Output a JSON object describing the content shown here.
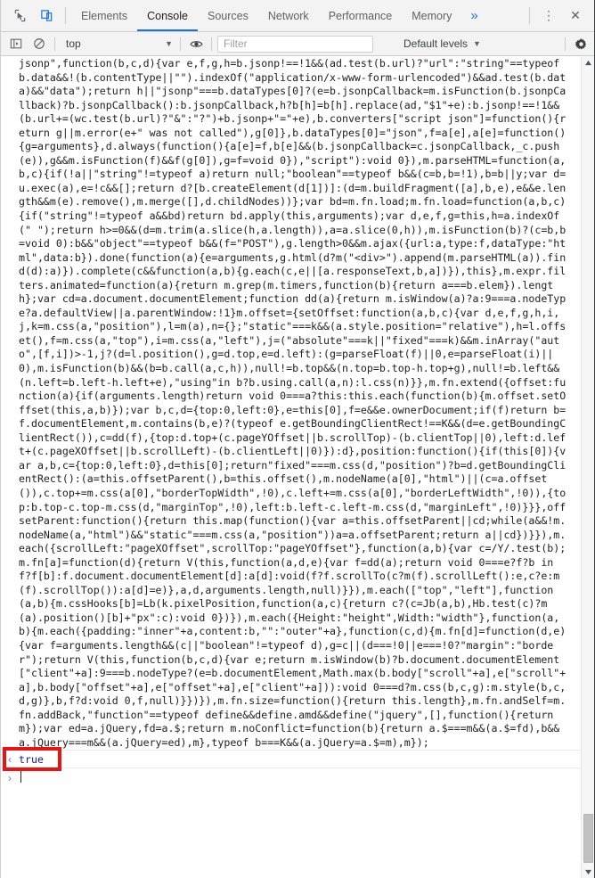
{
  "window": {
    "title": "Chrome DevTools - Console"
  },
  "tabbar": {
    "inspect_icon": "inspect-cursor-icon",
    "device_icon": "device-toolbar-icon",
    "tabs": [
      {
        "label": "Elements",
        "active": false
      },
      {
        "label": "Console",
        "active": true
      },
      {
        "label": "Sources",
        "active": false
      },
      {
        "label": "Network",
        "active": false
      },
      {
        "label": "Performance",
        "active": false
      },
      {
        "label": "Memory",
        "active": false
      }
    ],
    "more_tabs_label": "»",
    "menu_label": "⋮",
    "close_label": "✕",
    "active_underline_color": "#1a73e8",
    "more_tabs_color": "#1a73e8"
  },
  "console_toolbar": {
    "sidebar_toggle_icon": "show-console-sidebar-icon",
    "clear_icon": "clear-console-icon",
    "context": {
      "value": "top",
      "caret": "▼"
    },
    "eye_icon": "create-live-expression-icon",
    "filter": {
      "placeholder": "Filter",
      "value": ""
    },
    "levels": {
      "label": "Default levels",
      "caret": "▼"
    },
    "settings_icon": "gear-icon"
  },
  "console": {
    "log_gutter_marker": "",
    "log_text": "jsonp\",function(b,c,d){var e,f,g,h=b.jsonp!==!1&&(ad.test(b.url)?\"url\":\"string\"==typeof b.data&&!(b.contentType||\"\").indexOf(\"application/x-www-form-urlencoded\")&&ad.test(b.data)&&\"data\");return h||\"jsonp\"===b.dataTypes[0]?(e=b.jsonpCallback=m.isFunction(b.jsonpCallback)?b.jsonpCallback():b.jsonpCallback,h?b[h]=b[h].replace(ad,\"$1\"+e):b.jsonp!==!1&&(b.url+=(wc.test(b.url)?\"&\":\"?\")+b.jsonp+\"=\"+e),b.converters[\"script json\"]=function(){return g||m.error(e+\" was not called\"),g[0]},b.dataTypes[0]=\"json\",f=a[e],a[e]=function(){g=arguments},d.always(function(){a[e]=f,b[e]&&(b.jsonpCallback=c.jsonpCallback,_c.push(e)),g&&m.isFunction(f)&&f(g[0]),g=f=void 0}),\"script\"):void 0}),m.parseHTML=function(a,b,c){if(!a||\"string\"!=typeof a)return null;\"boolean\"==typeof b&&(c=b,b=!1),b=b||y;var d=u.exec(a),e=!c&&[];return d?[b.createElement(d[1])]:(d=m.buildFragment([a],b,e),e&&e.length&&m(e).remove(),m.merge([],d.childNodes))};var bd=m.fn.load;m.fn.load=function(a,b,c){if(\"string\"!=typeof a&&bd)return bd.apply(this,arguments);var d,e,f,g=this,h=a.indexOf(\" \");return h>=0&&(d=m.trim(a.slice(h,a.length)),a=a.slice(0,h)),m.isFunction(b)?(c=b,b=void 0):b&&\"object\"==typeof b&&(f=\"POST\"),g.length>0&&m.ajax({url:a,type:f,dataType:\"html\",data:b}).done(function(a){e=arguments,g.html(d?m(\"<div>\").append(m.parseHTML(a)).find(d):a)}).complete(c&&function(a,b){g.each(c,e||[a.responseText,b,a])}),this},m.expr.filters.animated=function(a){return m.grep(m.timers,function(b){return a===b.elem}).length};var cd=a.document.documentElement;function dd(a){return m.isWindow(a)?a:9===a.nodeType?a.defaultView||a.parentWindow:!1}m.offset={setOffset:function(a,b,c){var d,e,f,g,h,i,j,k=m.css(a,\"position\"),l=m(a),n={};\"static\"===k&&(a.style.position=\"relative\"),h=l.offset(),f=m.css(a,\"top\"),i=m.css(a,\"left\"),j=(\"absolute\"===k||\"fixed\"===k)&&m.inArray(\"auto\",[f,i])>-1,j?(d=l.position(),g=d.top,e=d.left):(g=parseFloat(f)||0,e=parseFloat(i)||0),m.isFunction(b)&&(b=b.call(a,c,h)),null!=b.top&&(n.top=b.top-h.top+g),null!=b.left&&(n.left=b.left-h.left+e),\"using\"in b?b.using.call(a,n):l.css(n)}},m.fn.extend({offset:function(a){if(arguments.length)return void 0===a?this:this.each(function(b){m.offset.setOffset(this,a,b)});var b,c,d={top:0,left:0},e=this[0],f=e&&e.ownerDocument;if(f)return b=f.documentElement,m.contains(b,e)?(typeof e.getBoundingClientRect!==K&&(d=e.getBoundingClientRect()),c=dd(f),{top:d.top+(c.pageYOffset||b.scrollTop)-(b.clientTop||0),left:d.left+(c.pageXOffset||b.scrollLeft)-(b.clientLeft||0)}):d},position:function(){if(this[0]){var a,b,c={top:0,left:0},d=this[0];return\"fixed\"===m.css(d,\"position\")?b=d.getBoundingClientRect():(a=this.offsetParent(),b=this.offset(),m.nodeName(a[0],\"html\")||(c=a.offset()),c.top+=m.css(a[0],\"borderTopWidth\",!0),c.left+=m.css(a[0],\"borderLeftWidth\",!0)),{top:b.top-c.top-m.css(d,\"marginTop\",!0),left:b.left-c.left-m.css(d,\"marginLeft\",!0)}}},offsetParent:function(){return this.map(function(){var a=this.offsetParent||cd;while(a&&!m.nodeName(a,\"html\")&&\"static\"===m.css(a,\"position\"))a=a.offsetParent;return a||cd})}}),m.each({scrollLeft:\"pageXOffset\",scrollTop:\"pageYOffset\"},function(a,b){var c=/Y/.test(b);m.fn[a]=function(d){return V(this,function(a,d,e){var f=dd(a);return void 0===e?f?b in f?f[b]:f.document.documentElement[d]:a[d]:void(f?f.scrollTo(c?m(f).scrollLeft():e,c?e:m(f).scrollTop()):a[d]=e)},a,d,arguments.length,null)}}),m.each([\"top\",\"left\"],function(a,b){m.cssHooks[b]=Lb(k.pixelPosition,function(a,c){return c?(c=Jb(a,b),Hb.test(c)?m(a).position()[b]+\"px\":c):void 0})}),m.each({Height:\"height\",Width:\"width\"},function(a,b){m.each({padding:\"inner\"+a,content:b,\"\":\"outer\"+a},function(c,d){m.fn[d]=function(d,e){var f=arguments.length&&(c||\"boolean\"!=typeof d),g=c||(d===!0||e===!0?\"margin\":\"border\");return V(this,function(b,c,d){var e;return m.isWindow(b)?b.document.documentElement[\"client\"+a]:9===b.nodeType?(e=b.documentElement,Math.max(b.body[\"scroll\"+a],e[\"scroll\"+a],b.body[\"offset\"+a],e[\"offset\"+a],e[\"client\"+a])):void 0===d?m.css(b,c,g):m.style(b,c,d,g)},b,f?d:void 0,f,null)}})}),m.fn.size=function(){return this.length},m.fn.andSelf=m.fn.addBack,\"function\"==typeof define&&define.amd&&define(\"jquery\",[],function(){return m});var ed=a.jQuery,fd=a.$;return m.noConflict=function(b){return a.$===m&&(a.$=fd),b&&a.jQuery===m&&(a.jQuery=ed),m},typeof b===K&&(a.jQuery=a.$=m),m});",
    "result_marker": "‹",
    "result_value": "true",
    "result_color": "#1a1aa6",
    "prompt_marker": "›",
    "prompt_value": ""
  },
  "scrollbar": {
    "up_arrow": "scroll-up-arrow",
    "down_arrow": "scroll-down-arrow",
    "thumb_top_pct": 93.5,
    "thumb_height_pct": 6.2
  },
  "annotation": {
    "color": "#ee1111",
    "target": "console-result-true"
  }
}
